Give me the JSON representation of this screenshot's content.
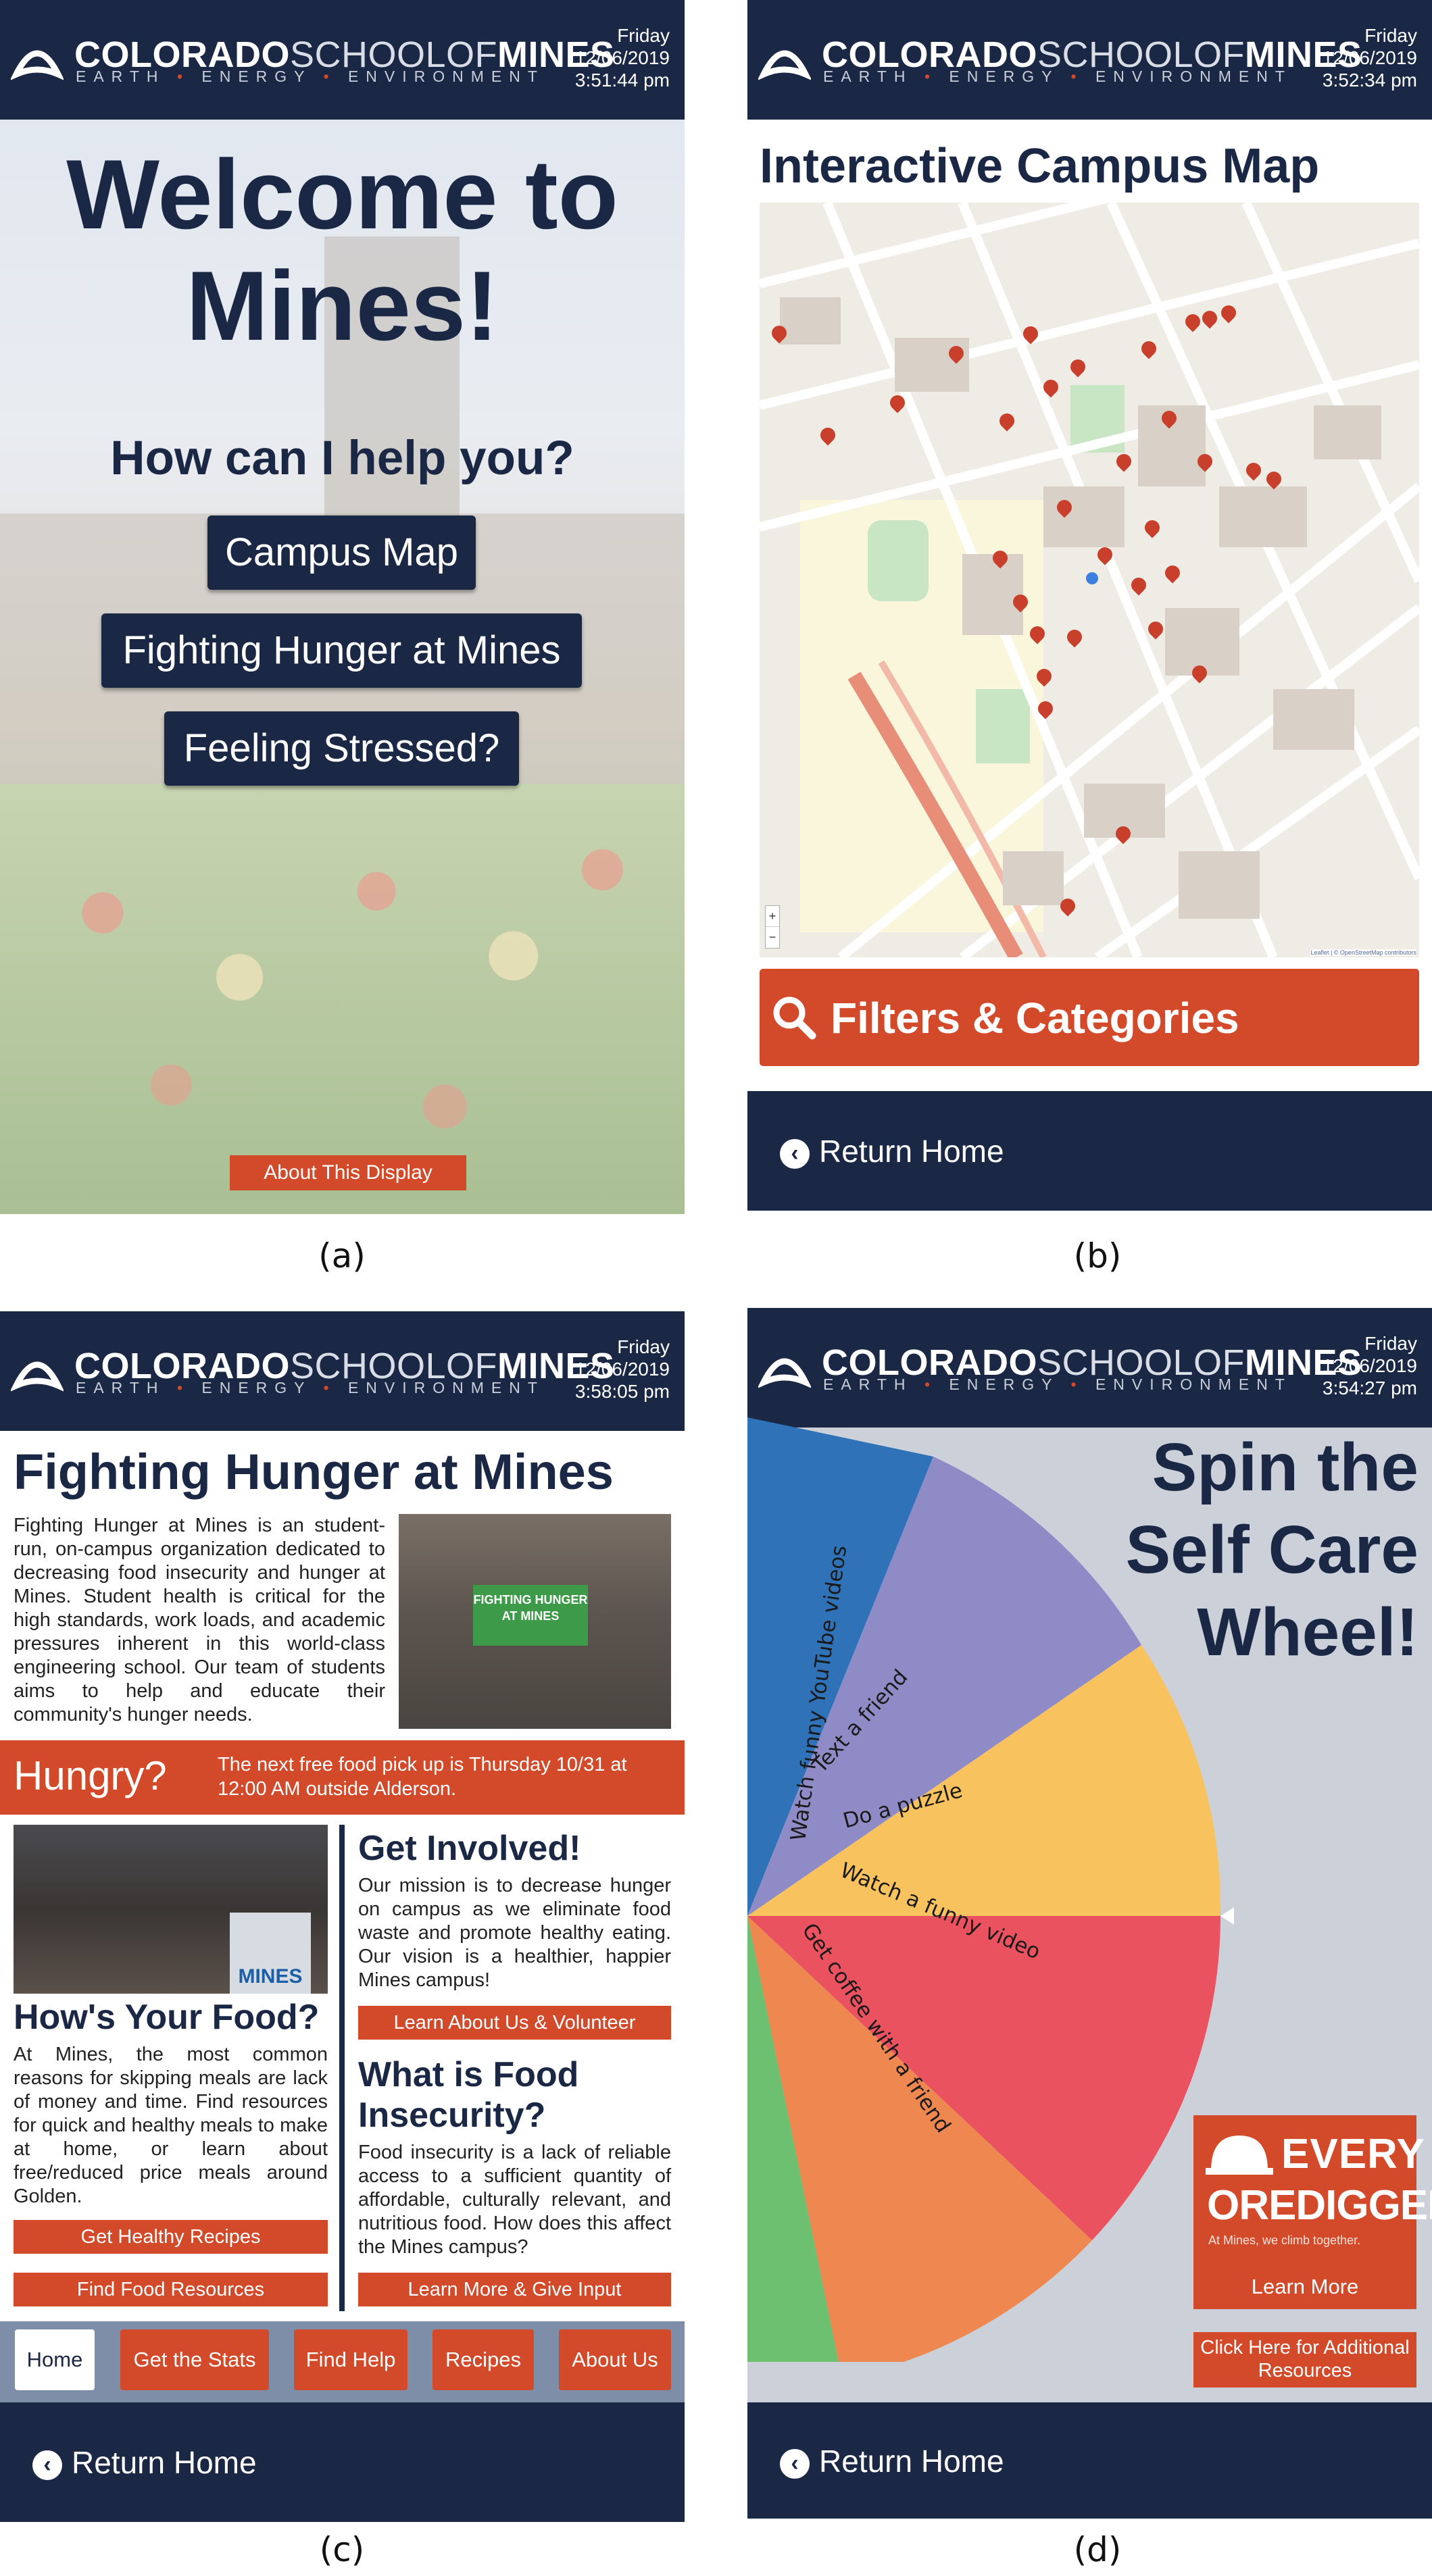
{
  "brand": {
    "name_a": "COLORADO",
    "name_b": "SCHOOL",
    "name_c": "OF",
    "name_d": "MINES",
    "tagline_a": "EARTH",
    "tagline_b": "ENERGY",
    "tagline_c": "ENVIRONMENT",
    "dot": "•"
  },
  "captions": [
    "(a)",
    "(b)",
    "(c)",
    "(d)"
  ],
  "a": {
    "day": "Friday",
    "date": "12/06/2019",
    "time": "3:51:44 pm",
    "title": "Welcome to Mines!",
    "subtitle": "How can I help you?",
    "buttons": [
      "Campus Map",
      "Fighting Hunger at Mines",
      "Feeling Stressed?"
    ],
    "about": "About This Display"
  },
  "b": {
    "day": "Friday",
    "date": "12/06/2019",
    "time": "3:52:34 pm",
    "title": "Interactive Campus Map",
    "zoom_in": "+",
    "zoom_out": "−",
    "attribution": "Leaflet | © OpenStreetMap contributors",
    "filters": "Filters & Categories",
    "return": "Return Home"
  },
  "c": {
    "day": "Friday",
    "date": "12/06/2019",
    "time": "3:58:05 pm",
    "title": "Fighting Hunger at Mines",
    "intro": "Fighting Hunger at Mines is an student-run, on-campus organization dedicated to decreasing food insecurity and hunger at Mines. Student health is critical for the high standards, work loads, and academic pressures inherent in this world-class engineering school. Our team of students aims to help and educate their community's hunger needs.",
    "banner_sign": "FIGHTING HUNGER AT MINES",
    "hungry": "Hungry?",
    "pickup": "The next free food pick up is Thursday 10/31 at 12:00 AM outside Alderson.",
    "podium": "MINES",
    "food_title": "How's Your Food?",
    "food_text": "At Mines, the most common reasons for skipping meals are lack of money and time. Find resources for quick and healthy meals to make at home, or learn about free/reduced price meals around Golden.",
    "btn_recipes": "Get Healthy Recipes",
    "btn_resources": "Find Food Resources",
    "involved_title": "Get Involved!",
    "involved_text": "Our mission is to decrease hunger on campus as we eliminate food waste and promote healthy eating. Our vision is a healthier, happier Mines campus!",
    "btn_learn": "Learn About Us & Volunteer",
    "insec_title": "What is Food Insecurity?",
    "insec_text": "Food insecurity is a lack of reliable access to a sufficient quantity of affordable, culturally relevant, and nutritious food. How does this affect the Mines campus?",
    "btn_input": "Learn More & Give Input",
    "tabs": [
      "Home",
      "Get the Stats",
      "Find Help",
      "Recipes",
      "About Us"
    ],
    "return": "Return Home"
  },
  "d": {
    "day": "Friday",
    "date": "12/06/2019",
    "time": "3:54:27 pm",
    "title_1": "Spin the",
    "title_2": "Self Care",
    "title_3": "Wheel!",
    "wheel": [
      "Watch funny YouTube videos",
      "Text a friend",
      "Do a puzzle",
      "Watch a funny video",
      "Get coffee with a friend"
    ],
    "wheel_colors": [
      "#2f72b8",
      "#8f8bc7",
      "#f8c35e",
      "#ea5260",
      "#ee8750",
      "#6cc070"
    ],
    "ad_1": "EVERY",
    "ad_2": "OREDIGGER",
    "ad_3": "At Mines, we climb together.",
    "ad_btn": "Learn More",
    "resources": "Click Here for Additional Resources",
    "return": "Return Home"
  }
}
